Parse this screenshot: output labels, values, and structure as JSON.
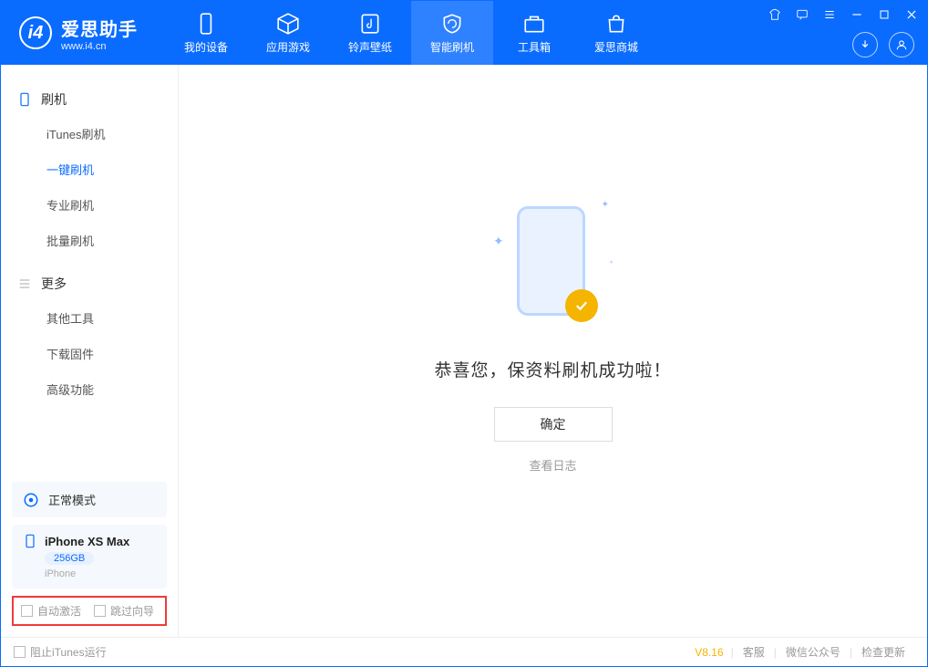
{
  "app": {
    "title": "爱思助手",
    "subtitle": "www.i4.cn"
  },
  "nav": [
    {
      "label": "我的设备"
    },
    {
      "label": "应用游戏"
    },
    {
      "label": "铃声壁纸"
    },
    {
      "label": "智能刷机"
    },
    {
      "label": "工具箱"
    },
    {
      "label": "爱思商城"
    }
  ],
  "sidebar": {
    "group1": {
      "title": "刷机"
    },
    "items1": [
      {
        "label": "iTunes刷机"
      },
      {
        "label": "一键刷机",
        "active": true
      },
      {
        "label": "专业刷机"
      },
      {
        "label": "批量刷机"
      }
    ],
    "group2": {
      "title": "更多"
    },
    "items2": [
      {
        "label": "其他工具"
      },
      {
        "label": "下载固件"
      },
      {
        "label": "高级功能"
      }
    ],
    "mode": "正常模式",
    "device": {
      "name": "iPhone XS Max",
      "capacity": "256GB",
      "type": "iPhone"
    },
    "checks": {
      "auto_activate": "自动激活",
      "skip_wizard": "跳过向导"
    }
  },
  "main": {
    "success_text": "恭喜您，保资料刷机成功啦！",
    "ok_button": "确定",
    "view_log": "查看日志"
  },
  "status": {
    "block_itunes": "阻止iTunes运行",
    "version": "V8.16",
    "links": [
      "客服",
      "微信公众号",
      "检查更新"
    ]
  }
}
